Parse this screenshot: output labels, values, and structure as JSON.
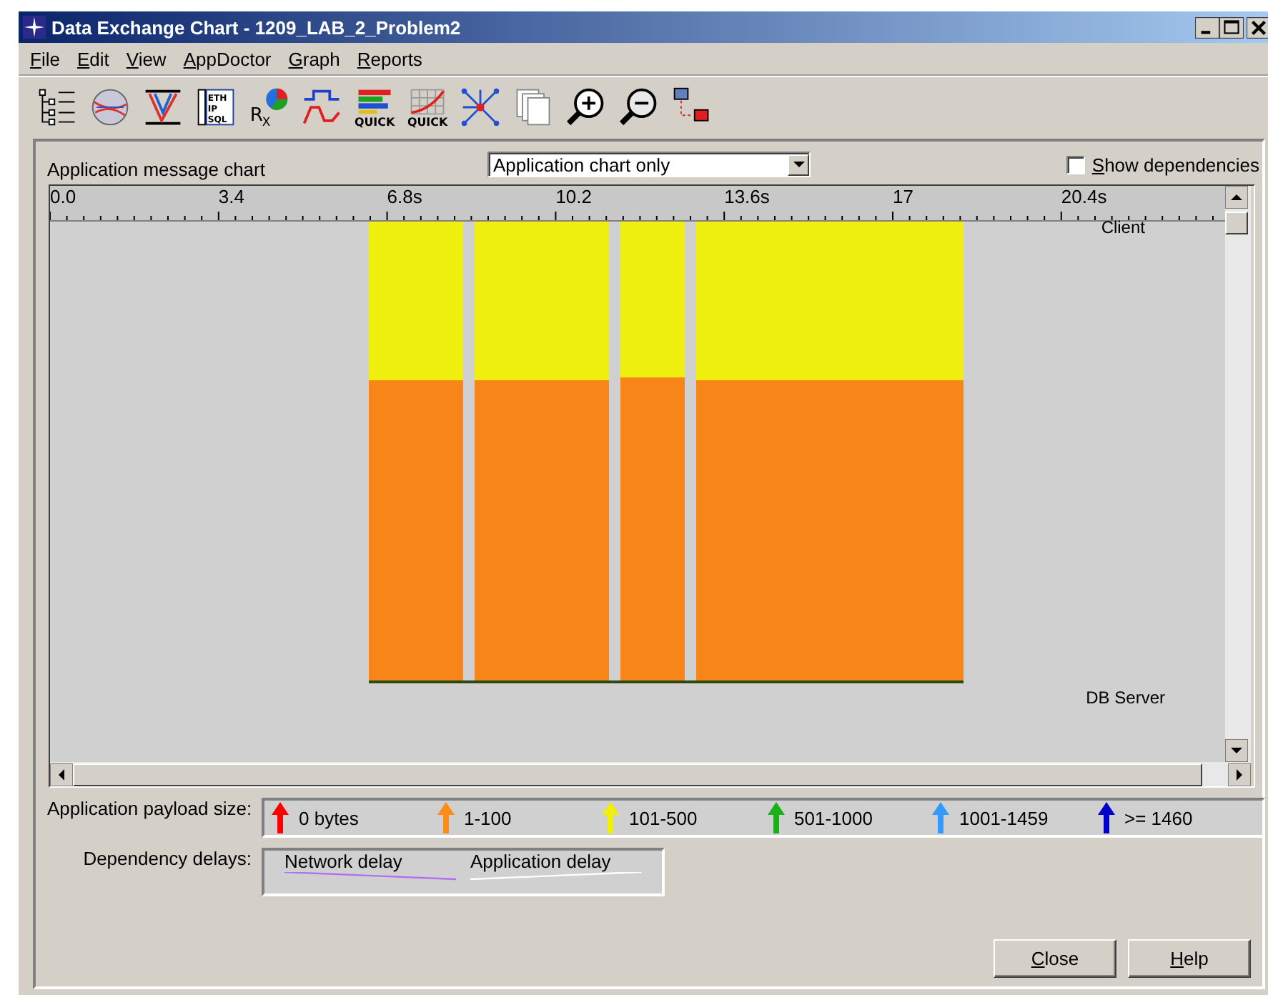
{
  "window": {
    "title": "Data Exchange Chart - 1209_LAB_2_Problem2"
  },
  "menu": [
    {
      "label": "File"
    },
    {
      "label": "Edit"
    },
    {
      "label": "View"
    },
    {
      "label": "AppDoctor"
    },
    {
      "label": "Graph"
    },
    {
      "label": "Reports"
    }
  ],
  "toolbar": [
    {
      "kind": "tree"
    },
    {
      "kind": "globe"
    },
    {
      "kind": "funnel"
    },
    {
      "kind": "stack",
      "captions": [
        "ETH",
        "IP",
        "SQL"
      ]
    },
    {
      "kind": "rx",
      "captions": [
        "R",
        "X"
      ]
    },
    {
      "kind": "wave"
    },
    {
      "kind": "quickbars",
      "captions": [
        "QUICK"
      ]
    },
    {
      "kind": "quickgrid",
      "captions": [
        "QUICK"
      ]
    },
    {
      "kind": "network"
    },
    {
      "kind": "pages"
    },
    {
      "kind": "zoomin"
    },
    {
      "kind": "zoomout"
    },
    {
      "kind": "nodes"
    }
  ],
  "chart_header": {
    "label": "Application message chart",
    "view_select": {
      "value": "Application chart only"
    },
    "show_dependencies": {
      "label": "Show dependencies",
      "checked": false
    }
  },
  "ruler": {
    "ticks": [
      "0.0",
      "3.4",
      "6.8s",
      "10.2",
      "13.6s",
      "17",
      "20.4s"
    ]
  },
  "tiers": {
    "top": "Client",
    "bottom": "DB Server"
  },
  "payload_legend": {
    "label": "Application payload size:",
    "items": [
      {
        "label": "0 bytes",
        "color": "#ff0000"
      },
      {
        "label": "1-100",
        "color": "#ff8c1a"
      },
      {
        "label": "101-500",
        "color": "#f0f000"
      },
      {
        "label": "501-1000",
        "color": "#19b019"
      },
      {
        "label": "1001-1459",
        "color": "#3399ff"
      },
      {
        "label": ">= 1460",
        "color": "#0000cc"
      }
    ]
  },
  "delay_legend": {
    "label": "Dependency delays:",
    "items": [
      {
        "label": "Network delay",
        "color": "#b070f0"
      },
      {
        "label": "Application delay",
        "color": "#ffffff"
      }
    ]
  },
  "buttons": [
    {
      "label": "Close"
    },
    {
      "label": "Help"
    }
  ]
}
